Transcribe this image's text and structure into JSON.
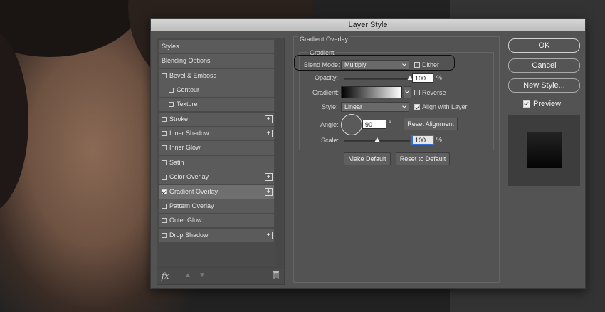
{
  "dialog": {
    "title": "Layer Style"
  },
  "styles_list": {
    "header": "Styles",
    "items": [
      {
        "label": "Blending Options",
        "checkbox": false,
        "checked": false,
        "indent": false,
        "plus": false,
        "selected": false
      },
      {
        "label": "Bevel & Emboss",
        "checkbox": true,
        "checked": false,
        "indent": false,
        "plus": false,
        "selected": false
      },
      {
        "label": "Contour",
        "checkbox": true,
        "checked": false,
        "indent": true,
        "plus": false,
        "selected": false
      },
      {
        "label": "Texture",
        "checkbox": true,
        "checked": false,
        "indent": true,
        "plus": false,
        "selected": false
      },
      {
        "label": "Stroke",
        "checkbox": true,
        "checked": false,
        "indent": false,
        "plus": true,
        "selected": false
      },
      {
        "label": "Inner Shadow",
        "checkbox": true,
        "checked": false,
        "indent": false,
        "plus": true,
        "selected": false
      },
      {
        "label": "Inner Glow",
        "checkbox": true,
        "checked": false,
        "indent": false,
        "plus": false,
        "selected": false
      },
      {
        "label": "Satin",
        "checkbox": true,
        "checked": false,
        "indent": false,
        "plus": false,
        "selected": false
      },
      {
        "label": "Color Overlay",
        "checkbox": true,
        "checked": false,
        "indent": false,
        "plus": true,
        "selected": false
      },
      {
        "label": "Gradient Overlay",
        "checkbox": true,
        "checked": true,
        "indent": false,
        "plus": true,
        "selected": true
      },
      {
        "label": "Pattern Overlay",
        "checkbox": true,
        "checked": false,
        "indent": false,
        "plus": false,
        "selected": false
      },
      {
        "label": "Outer Glow",
        "checkbox": true,
        "checked": false,
        "indent": false,
        "plus": false,
        "selected": false
      },
      {
        "label": "Drop Shadow",
        "checkbox": true,
        "checked": false,
        "indent": false,
        "plus": true,
        "selected": false
      }
    ],
    "footer": {
      "fx": "fx",
      "plus_symbol": "+"
    }
  },
  "panel": {
    "title": "Gradient Overlay",
    "group_title": "Gradient",
    "blend_mode": {
      "label": "Blend Mode:",
      "value": "Multiply"
    },
    "dither": {
      "label": "Dither",
      "checked": false
    },
    "opacity": {
      "label": "Opacity:",
      "value": "100",
      "unit": "%",
      "level": 1.0
    },
    "gradient": {
      "label": "Gradient:"
    },
    "reverse": {
      "label": "Reverse",
      "checked": false
    },
    "style": {
      "label": "Style:",
      "value": "Linear"
    },
    "align_with_layer": {
      "label": "Align with Layer",
      "checked": true
    },
    "angle": {
      "label": "Angle:",
      "value": "90",
      "unit": "°"
    },
    "reset_alignment": "Reset Alignment",
    "scale": {
      "label": "Scale:",
      "value": "100",
      "unit": "%",
      "level": 0.5
    },
    "make_default": "Make Default",
    "reset_to_default": "Reset to Default"
  },
  "right": {
    "ok": "OK",
    "cancel": "Cancel",
    "new_style": "New Style...",
    "preview": {
      "label": "Preview",
      "checked": true
    }
  }
}
